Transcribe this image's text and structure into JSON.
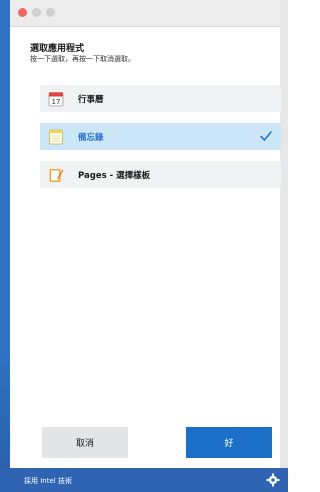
{
  "dialog": {
    "title": "選取應用程式",
    "subtitle": "按一下選取，再按一下取消選取。"
  },
  "apps": [
    {
      "label": "行事曆",
      "icon": "calendar-icon",
      "calendar_date": "17",
      "selected": false
    },
    {
      "label": "備忘錄",
      "icon": "notes-icon",
      "selected": true
    },
    {
      "label": "Pages - 選擇樣板",
      "icon": "pages-icon",
      "selected": false
    }
  ],
  "buttons": {
    "cancel_label": "取消",
    "ok_label": "好"
  },
  "footer": {
    "text": "採用 Intel 技術"
  },
  "colors": {
    "accent": "#1c6fc7",
    "selected_row": "#cbe6f7",
    "footer_bar": "#2f64b3"
  }
}
